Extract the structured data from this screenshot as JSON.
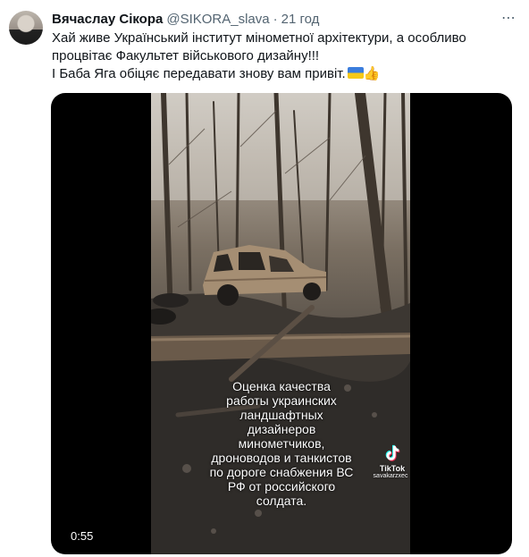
{
  "tweet": {
    "display_name": "Вячаслау Сікора",
    "handle": "@SIKORA_slava",
    "separator": "·",
    "time": "21 год",
    "more_icon": "⋯",
    "text_lines": [
      "Хай живе Український інститут мінометної архітектури, а особливо",
      "процвітає Факультет військового дизайну!!!",
      "І Баба Яга обіцяє передавати знову вам привіт."
    ],
    "emoji_flag": "ukraine-flag",
    "emoji_thumb": "👍"
  },
  "media": {
    "duration": "0:55",
    "caption": "Оценка качества\nработы украинских\nландшафтных\nдизайнеров\nминометчиков,\nдроноводов и танкистов\nпо дороге снабжения ВС\nРФ от российского\nсолдата.",
    "tiktok_label": "TikTok",
    "tiktok_user": "savakarzxec"
  }
}
